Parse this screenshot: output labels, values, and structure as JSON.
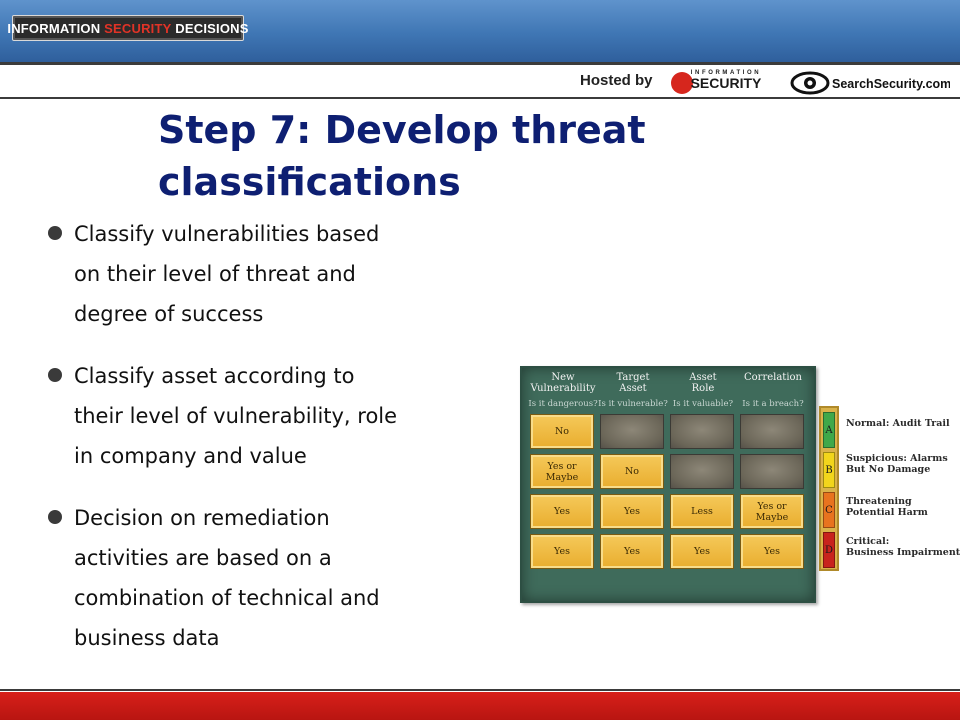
{
  "header": {
    "logo_part1": "INFORMATION ",
    "logo_accent": "SECURITY",
    "logo_part2": " DECISIONS",
    "hosted_by": "Hosted by",
    "infosec_top": "INFORMATION",
    "infosec_main": "SECURITY",
    "searchsecurity": "SearchSecurity.com",
    "colors": {
      "band": "#3f76b4",
      "accent_red": "#e03327"
    }
  },
  "slide": {
    "title_line1": "Step 7: Develop threat",
    "title_line2": "classifications",
    "title_color": "#0e1f72",
    "bullets": [
      {
        "lines": [
          "Classify vulnerabilities based",
          "on their level of threat and",
          "degree of success"
        ]
      },
      {
        "lines": [
          "Classify asset according to",
          "their level of vulnerability, role",
          "in company and value"
        ]
      },
      {
        "lines": [
          "Decision on remediation",
          "activities are based on a",
          "combination of technical and",
          "business data"
        ]
      }
    ]
  },
  "figure": {
    "columns": [
      {
        "title_1": "New",
        "title_2": "Vulnerability",
        "question": "Is it dangerous?"
      },
      {
        "title_1": "Target",
        "title_2": "Asset",
        "question": "Is it vulnerable?"
      },
      {
        "title_1": "Asset",
        "title_2": "Role",
        "question": "Is it valuable?"
      },
      {
        "title_1": "Correlation",
        "title_2": "",
        "question": "Is it a breach?"
      }
    ],
    "rows": [
      [
        {
          "text": "No",
          "on": true
        },
        {
          "text": "",
          "on": false
        },
        {
          "text": "",
          "on": false
        },
        {
          "text": "",
          "on": false
        }
      ],
      [
        {
          "text": "Yes or Maybe",
          "on": true
        },
        {
          "text": "No",
          "on": true
        },
        {
          "text": "",
          "on": false
        },
        {
          "text": "",
          "on": false
        }
      ],
      [
        {
          "text": "Yes",
          "on": true
        },
        {
          "text": "Yes",
          "on": true
        },
        {
          "text": "Less",
          "on": true
        },
        {
          "text": "Yes or Maybe",
          "on": true
        }
      ],
      [
        {
          "text": "Yes",
          "on": true
        },
        {
          "text": "Yes",
          "on": true
        },
        {
          "text": "Yes",
          "on": true
        },
        {
          "text": "Yes",
          "on": true
        }
      ]
    ],
    "legend": [
      {
        "letter": "A",
        "color": "#3fa84a",
        "line1": "Normal: Audit Trail",
        "line2": ""
      },
      {
        "letter": "B",
        "color": "#f2d51c",
        "line1": "Suspicious: Alarms",
        "line2": "But No Damage"
      },
      {
        "letter": "C",
        "color": "#e8731f",
        "line1": "Threatening",
        "line2": "Potential Harm"
      },
      {
        "letter": "D",
        "color": "#c8231d",
        "line1": "Critical:",
        "line2": "Business Impairment"
      }
    ]
  },
  "footer": {
    "color": "#c81a14"
  }
}
